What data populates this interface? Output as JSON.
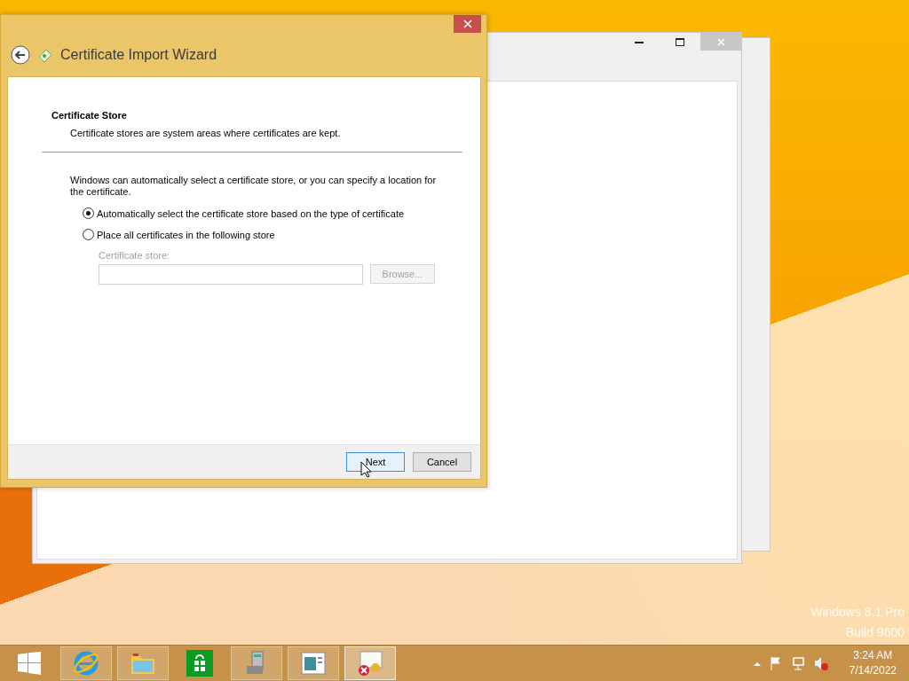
{
  "wizard": {
    "title": "Certificate Import Wizard",
    "heading": "Certificate Store",
    "subheading": "Certificate stores are system areas where certificates are kept.",
    "intro": "Windows can automatically select a certificate store, or you can specify a location for the certificate.",
    "options": [
      {
        "label": "Automatically select the certificate store based on the type of certificate",
        "selected": true
      },
      {
        "label": "Place all certificates in the following store",
        "selected": false
      }
    ],
    "store_label": "Certificate store:",
    "browse_button": {
      "label": "Browse...",
      "disabled": true
    },
    "buttons": [
      {
        "label": "Next",
        "focused": true
      },
      {
        "label": "Cancel",
        "focused": false
      }
    ]
  },
  "taskbar": {
    "apps": [
      {
        "kind": "ie",
        "running": true,
        "active": false
      },
      {
        "kind": "explorer",
        "running": true,
        "active": false
      },
      {
        "kind": "store",
        "running": false,
        "active": false
      },
      {
        "kind": "tools",
        "running": true,
        "active": false
      },
      {
        "kind": "reader",
        "running": true,
        "active": false
      },
      {
        "kind": "certificate",
        "running": true,
        "active": true
      }
    ],
    "time": "3:24 AM",
    "date": "7/14/2022"
  },
  "desktop_text": [
    "Windows 8.1 Pro",
    "Build 9600"
  ]
}
